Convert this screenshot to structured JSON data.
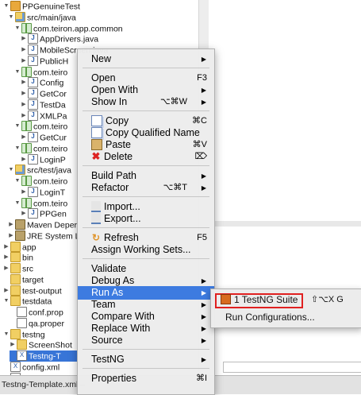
{
  "tree": [
    {
      "label": "PPGenuineTest",
      "icon": "project-icon",
      "twisty": "▼"
    },
    {
      "label": "src/main/java",
      "icon": "source-folder-icon",
      "twisty": "▼"
    },
    {
      "label": "com.teiron.app.common",
      "icon": "package-icon",
      "twisty": "▼"
    },
    {
      "label": "AppDrivers.java",
      "icon": "java-file-icon",
      "twisty": "▶"
    },
    {
      "label": "MobileScreen.java",
      "icon": "java-file-icon",
      "twisty": "▶"
    },
    {
      "label": "PublicH",
      "icon": "java-file-icon",
      "twisty": "▶"
    },
    {
      "label": "com.teiro",
      "icon": "package-icon",
      "twisty": "▼"
    },
    {
      "label": "Config",
      "icon": "java-file-icon",
      "twisty": "▶"
    },
    {
      "label": "GetCor",
      "icon": "java-file-icon",
      "twisty": "▶"
    },
    {
      "label": "TestDa",
      "icon": "java-file-icon",
      "twisty": "▶"
    },
    {
      "label": "XMLPa",
      "icon": "java-file-icon",
      "twisty": "▶"
    },
    {
      "label": "com.teiro",
      "icon": "package-icon",
      "twisty": "▼"
    },
    {
      "label": "GetCur",
      "icon": "java-file-icon",
      "twisty": "▶"
    },
    {
      "label": "com.teiro",
      "icon": "package-icon",
      "twisty": "▼"
    },
    {
      "label": "LoginP",
      "icon": "java-file-icon",
      "twisty": "▶"
    },
    {
      "label": "src/test/java",
      "icon": "source-folder-icon",
      "twisty": "▼"
    },
    {
      "label": "com.teiro",
      "icon": "package-icon",
      "twisty": "▼"
    },
    {
      "label": "LoginT",
      "icon": "java-file-icon",
      "twisty": "▶"
    },
    {
      "label": "com.teiro",
      "icon": "package-icon",
      "twisty": "▼"
    },
    {
      "label": "PPGen",
      "icon": "java-file-icon",
      "twisty": "▶"
    },
    {
      "label": "Maven Deper",
      "icon": "library-icon",
      "twisty": "▶"
    },
    {
      "label": "JRE System L",
      "icon": "library-icon",
      "twisty": "▶"
    },
    {
      "label": "app",
      "icon": "folder-icon",
      "twisty": "▶"
    },
    {
      "label": "bin",
      "icon": "folder-icon",
      "twisty": "▶"
    },
    {
      "label": "src",
      "icon": "folder-icon",
      "twisty": "▶"
    },
    {
      "label": "target",
      "icon": "folder-icon",
      "twisty": ""
    },
    {
      "label": "test-output",
      "icon": "folder-icon",
      "twisty": "▶"
    },
    {
      "label": "testdata",
      "icon": "folder-icon",
      "twisty": "▼"
    },
    {
      "label": "conf.prop",
      "icon": "file-icon",
      "twisty": ""
    },
    {
      "label": "qa.proper",
      "icon": "file-icon",
      "twisty": ""
    },
    {
      "label": "testng",
      "icon": "folder-icon",
      "twisty": "▼"
    },
    {
      "label": "ScreenShot",
      "icon": "folder-icon",
      "twisty": "▶"
    },
    {
      "label": "Testng-T",
      "icon": "xml-file-icon",
      "twisty": "",
      "selected": true
    },
    {
      "label": "config.xml",
      "icon": "xml-file-icon",
      "twisty": ""
    },
    {
      "label": "pom.xml",
      "icon": "maven-file-icon",
      "twisty": ""
    }
  ],
  "status_text": "Testng-Template.xml –",
  "menu": [
    {
      "label": "New",
      "submenu": true
    },
    {
      "sep": true
    },
    {
      "label": "Open",
      "shortcut": "F3"
    },
    {
      "label": "Open With",
      "submenu": true
    },
    {
      "label": "Show In",
      "shortcut": "⌥⌘W",
      "submenu": true
    },
    {
      "sep": true
    },
    {
      "label": "Copy",
      "shortcut": "⌘C",
      "icon": "copy-icon"
    },
    {
      "label": "Copy Qualified Name",
      "icon": "copy-qualified-icon"
    },
    {
      "label": "Paste",
      "shortcut": "⌘V",
      "icon": "paste-icon"
    },
    {
      "label": "Delete",
      "shortcut": "⌦",
      "icon": "delete-icon"
    },
    {
      "sep": true
    },
    {
      "label": "Build Path",
      "submenu": true
    },
    {
      "label": "Refactor",
      "shortcut": "⌥⌘T",
      "submenu": true
    },
    {
      "sep": true
    },
    {
      "label": "Import...",
      "icon": "import-icon"
    },
    {
      "label": "Export...",
      "icon": "export-icon"
    },
    {
      "sep": true
    },
    {
      "label": "Refresh",
      "shortcut": "F5",
      "icon": "refresh-icon"
    },
    {
      "label": "Assign Working Sets..."
    },
    {
      "sep": true
    },
    {
      "label": "Validate"
    },
    {
      "label": "Debug As",
      "submenu": true
    },
    {
      "label": "Run As",
      "submenu": true,
      "active": true
    },
    {
      "label": "Team",
      "submenu": true
    },
    {
      "label": "Compare With",
      "submenu": true
    },
    {
      "label": "Replace With",
      "submenu": true
    },
    {
      "label": "Source",
      "submenu": true
    },
    {
      "sep": true
    },
    {
      "label": "TestNG",
      "submenu": true
    },
    {
      "sep": true
    },
    {
      "label": "Properties",
      "shortcut": "⌘I"
    }
  ],
  "submenu": {
    "items": [
      {
        "label": "1 TestNG Suite",
        "shortcut": "⇧⌥X G",
        "icon": "testng-icon",
        "highlighted": true
      },
      {
        "label": "Run Configurations..."
      }
    ]
  }
}
